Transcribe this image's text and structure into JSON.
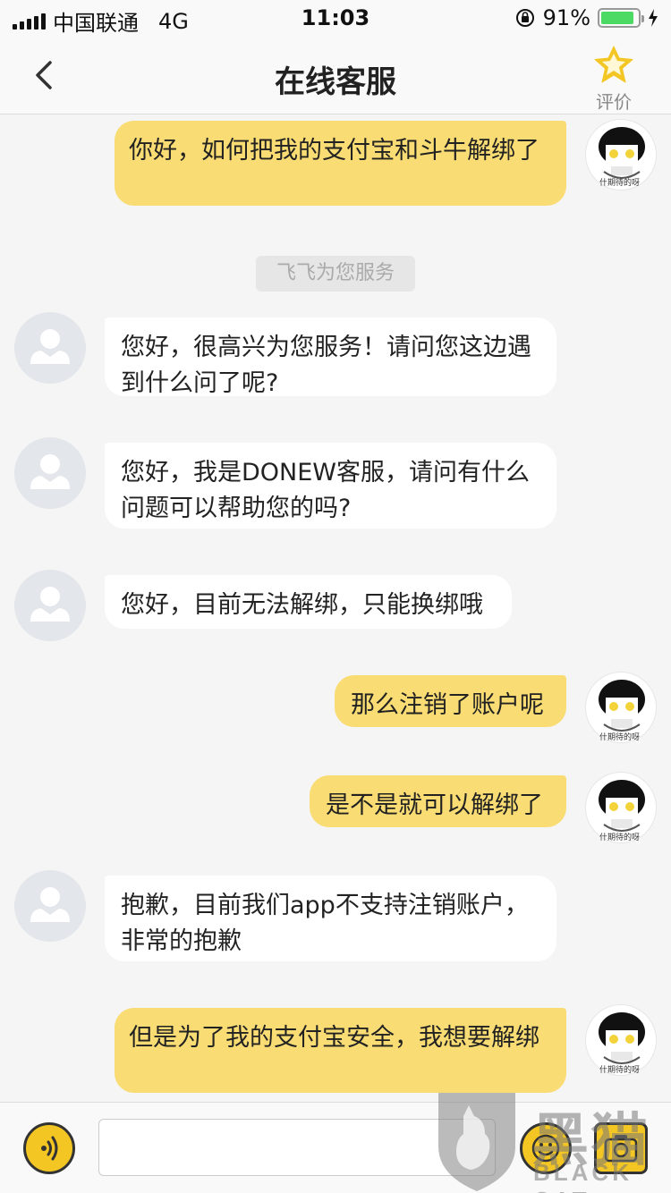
{
  "status_bar": {
    "carrier": "中国联通",
    "network": "4G",
    "time": "11:03",
    "battery_percent": "91%",
    "battery_level": 0.91,
    "battery_color": "#4cd964"
  },
  "nav": {
    "back_icon": "chevron-left-icon",
    "title": "在线客服",
    "rate_label": "评价",
    "rate_icon": "star-icon"
  },
  "chat": {
    "system_tip": "飞飞为您服务",
    "messages": [
      {
        "from": "me",
        "text": "你好，如何把我的支付宝和斗牛解绑了"
      },
      {
        "from": "cs",
        "text": "您好，很高兴为您服务！请问您这边遇到什么问了呢?"
      },
      {
        "from": "cs",
        "text": "您好，我是DONEW客服，请问有什么问题可以帮助您的吗?"
      },
      {
        "from": "cs",
        "text": "您好，目前无法解绑，只能换绑哦"
      },
      {
        "from": "me",
        "text": "那么注销了账户呢"
      },
      {
        "from": "me",
        "text": "是不是就可以解绑了"
      },
      {
        "from": "cs",
        "text": "抱歉，目前我们app不支持注销账户，非常的抱歉"
      },
      {
        "from": "me",
        "text": "但是为了我的支付宝安全，我想要解绑"
      }
    ],
    "avatar_caption": "什期待的呀",
    "bubble_color_me": "#f9dc73",
    "bubble_color_cs": "#ffffff"
  },
  "input_bar": {
    "voice_icon": "voice-icon",
    "input_value": "",
    "emoji_icon": "emoji-icon",
    "photo_icon": "camera-icon",
    "accent": "#f3c623"
  },
  "watermark": {
    "cn": "黑猫",
    "en": "BLACK CAT"
  }
}
